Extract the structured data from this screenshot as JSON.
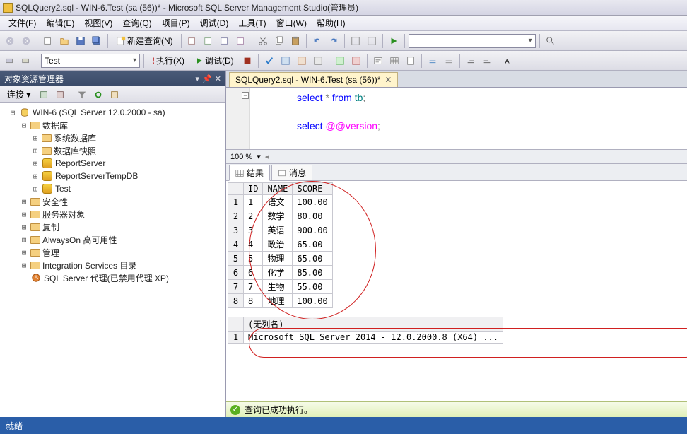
{
  "title": "SQLQuery2.sql - WIN-6.Test (sa (56))* - Microsoft SQL Server Management Studio(管理员)",
  "menu": [
    "文件(F)",
    "编辑(E)",
    "视图(V)",
    "查询(Q)",
    "项目(P)",
    "调试(D)",
    "工具(T)",
    "窗口(W)",
    "帮助(H)"
  ],
  "toolbar1": {
    "new_query": "新建查询(N)"
  },
  "toolbar2": {
    "db_combo": "Test",
    "execute": "执行(X)",
    "debug": "调试(D)"
  },
  "object_explorer": {
    "title": "对象资源管理器",
    "connect_label": "连接 ▾",
    "root": "WIN-6 (SQL Server 12.0.2000 - sa)",
    "nodes": {
      "databases": "数据库",
      "sys_db": "系统数据库",
      "snapshots": "数据库快照",
      "report_server": "ReportServer",
      "report_server_temp": "ReportServerTempDB",
      "test_db": "Test",
      "security": "安全性",
      "server_objects": "服务器对象",
      "replication": "复制",
      "alwayson": "AlwaysOn 高可用性",
      "management": "管理",
      "integration": "Integration Services 目录",
      "agent": "SQL Server 代理(已禁用代理 XP)"
    }
  },
  "doc_tab": "SQLQuery2.sql - WIN-6.Test (sa (56))*",
  "sql": {
    "l1a": "select ",
    "l1b": "* ",
    "l1c": "from ",
    "l1d": "tb",
    "l1e": ";",
    "l3a": "select ",
    "l3b": "@@version",
    "l3e": ";"
  },
  "zoom": "100 %",
  "result_tabs": {
    "results": "结果",
    "messages": "消息"
  },
  "grid1": {
    "headers": [
      "ID",
      "NAME",
      "SCORE"
    ],
    "rows": [
      {
        "n": "1",
        "id": "1",
        "name": "语文",
        "score": "100.00"
      },
      {
        "n": "2",
        "id": "2",
        "name": "数学",
        "score": "80.00"
      },
      {
        "n": "3",
        "id": "3",
        "name": "英语",
        "score": "900.00"
      },
      {
        "n": "4",
        "id": "4",
        "name": "政治",
        "score": "65.00"
      },
      {
        "n": "5",
        "id": "5",
        "name": "物理",
        "score": "65.00"
      },
      {
        "n": "6",
        "id": "6",
        "name": "化学",
        "score": "85.00"
      },
      {
        "n": "7",
        "id": "7",
        "name": "生物",
        "score": "55.00"
      },
      {
        "n": "8",
        "id": "8",
        "name": "地理",
        "score": "100.00"
      }
    ]
  },
  "grid2": {
    "header": "(无列名)",
    "row_n": "1",
    "value": "Microsoft SQL Server 2014 - 12.0.2000.8 (X64)  ..."
  },
  "status_msg": "查询已成功执行。",
  "statusbar": "就绪"
}
